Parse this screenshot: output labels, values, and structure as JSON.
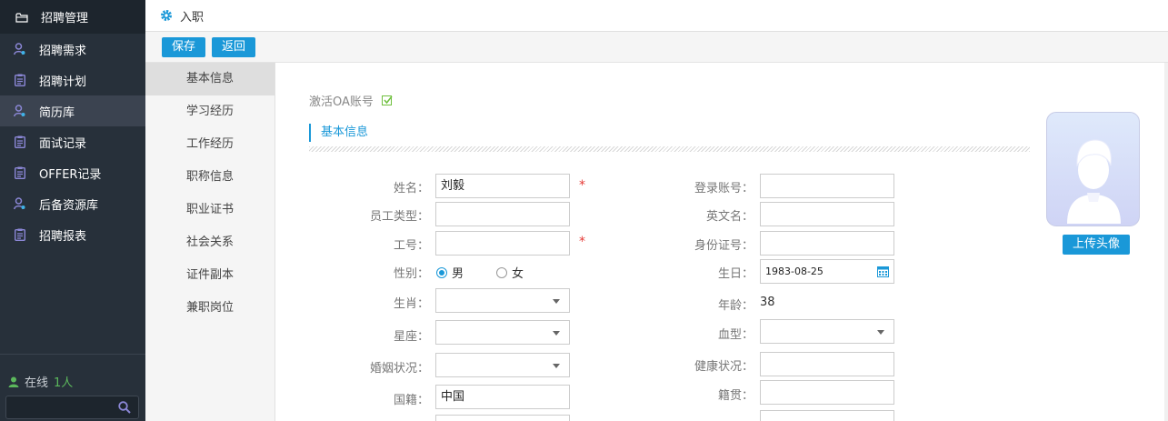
{
  "sidebar": {
    "header": "招聘管理",
    "items": [
      {
        "label": "招聘需求",
        "icon": "person-icon"
      },
      {
        "label": "招聘计划",
        "icon": "clipboard-icon"
      },
      {
        "label": "简历库",
        "icon": "person-icon"
      },
      {
        "label": "面试记录",
        "icon": "clipboard-icon"
      },
      {
        "label": "OFFER记录",
        "icon": "clipboard-icon"
      },
      {
        "label": "后备资源库",
        "icon": "person-icon"
      },
      {
        "label": "招聘报表",
        "icon": "clipboard-icon"
      }
    ],
    "active_index": 2,
    "online_label": "在线",
    "online_count": "1人",
    "search_placeholder": ""
  },
  "topbar": {
    "title": "入职"
  },
  "toolbar": {
    "save_label": "保存",
    "back_label": "返回"
  },
  "subnav": {
    "items": [
      "基本信息",
      "学习经历",
      "工作经历",
      "职称信息",
      "职业证书",
      "社会关系",
      "证件副本",
      "兼职岗位"
    ],
    "active_index": 0
  },
  "form": {
    "activate_oa": "激活OA账号",
    "section_title": "基本信息",
    "name_label": "姓名：",
    "name_value": "刘毅",
    "emp_type_label": "员工类型：",
    "emp_type_value": "",
    "emp_no_label": "工号：",
    "emp_no_value": "",
    "gender_label": "性别：",
    "gender_male": "男",
    "gender_female": "女",
    "zodiac_label": "生肖：",
    "zodiac_value": "",
    "constellation_label": "星座：",
    "constellation_value": "",
    "marital_label": "婚姻状况：",
    "marital_value": "",
    "nationality_label": "国籍：",
    "nationality_value": "中国",
    "login_label": "登录账号：",
    "login_value": "",
    "english_label": "英文名：",
    "english_value": "",
    "idcard_label": "身份证号：",
    "idcard_value": "",
    "birthday_label": "生日：",
    "birthday_value": "1983-08-25",
    "age_label": "年龄：",
    "age_value": "38",
    "blood_label": "血型：",
    "blood_value": "",
    "health_label": "健康状况：",
    "health_value": "",
    "origin_label": "籍贯：",
    "origin_value": "",
    "required_mark": "*",
    "upload_label": "上传头像"
  },
  "colors": {
    "accent": "#1a98d8",
    "sidebar_bg": "#27303a",
    "required": "#e53935",
    "online": "#5cb85c"
  }
}
